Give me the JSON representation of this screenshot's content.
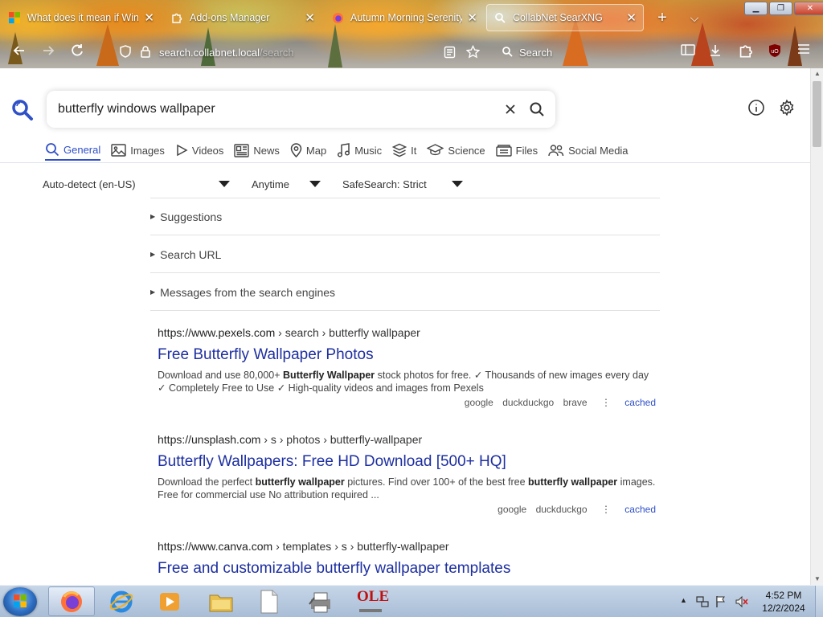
{
  "browser": {
    "tabs": [
      {
        "title": "What does it mean if Wind",
        "close": "✕",
        "icon": "windows-logo-icon"
      },
      {
        "title": "Add-ons Manager",
        "close": "✕",
        "icon": "puzzle-icon"
      },
      {
        "title": "Autumn Morning Serenity",
        "close": "✕",
        "icon": "firefox-icon"
      },
      {
        "title": "CollabNet SearXNG",
        "close": "✕",
        "icon": "search-icon",
        "active": true
      }
    ],
    "new_tab": "+",
    "tab_list": "⌵",
    "url": {
      "host": "search.collabnet.local",
      "path": "/search"
    },
    "searchbar_placeholder": "Search",
    "window_controls": {
      "minimize": "▁",
      "maximize": "❐",
      "close": "✕"
    }
  },
  "search": {
    "query": "butterfly windows wallpaper",
    "categories": [
      {
        "label": "General",
        "icon": "search-icon",
        "active": true
      },
      {
        "label": "Images",
        "icon": "image-icon"
      },
      {
        "label": "Videos",
        "icon": "play-icon"
      },
      {
        "label": "News",
        "icon": "newspaper-icon"
      },
      {
        "label": "Map",
        "icon": "map-pin-icon"
      },
      {
        "label": "Music",
        "icon": "music-icon"
      },
      {
        "label": "It",
        "icon": "layers-icon"
      },
      {
        "label": "Science",
        "icon": "graduation-cap-icon"
      },
      {
        "label": "Files",
        "icon": "files-icon"
      },
      {
        "label": "Social Media",
        "icon": "people-icon"
      }
    ],
    "filters": {
      "language": "Auto-detect (en-US)",
      "time": "Anytime",
      "safesearch": "SafeSearch: Strict"
    },
    "collapsibles": [
      "Suggestions",
      "Search URL",
      "Messages from the search engines"
    ]
  },
  "results": [
    {
      "host": "https://www.pexels.com",
      "path": "› search › butterfly wallpaper",
      "title": "Free Butterfly Wallpaper Photos",
      "content": [
        {
          "t": "Download and use 80,000+ "
        },
        {
          "t": "Butterfly Wallpaper",
          "b": true
        },
        {
          "t": " stock photos for free. ✓ Thousands of new images every day ✓ Completely Free to Use ✓ High-quality videos and images from Pexels"
        }
      ],
      "engines": [
        "google",
        "duckduckgo",
        "brave"
      ],
      "cached": "cached"
    },
    {
      "host": "https://unsplash.com",
      "path": "› s › photos › butterfly-wallpaper",
      "title": "Butterfly Wallpapers: Free HD Download [500+ HQ]",
      "content": [
        {
          "t": "Download the perfect "
        },
        {
          "t": "butterfly wallpaper",
          "b": true
        },
        {
          "t": " pictures. Find over 100+ of the best free "
        },
        {
          "t": "butterfly wallpaper",
          "b": true
        },
        {
          "t": " images. Free for commercial use No attribution required ..."
        }
      ],
      "engines": [
        "google",
        "duckduckgo"
      ],
      "cached": "cached"
    },
    {
      "host": "https://www.canva.com",
      "path": "› templates › s › butterfly-wallpaper",
      "title": "Free and customizable butterfly wallpaper templates",
      "content": [],
      "engines": [],
      "cached": ""
    }
  ],
  "taskbar": {
    "apps": [
      "firefox-icon",
      "internet-explorer-icon",
      "media-player-icon",
      "file-explorer-icon",
      "document-icon",
      "printer-app-icon",
      "ole-app-icon"
    ],
    "ole_label": "OLE",
    "clock": {
      "time": "4:52 PM",
      "date": "12/2/2024"
    }
  },
  "colors": {
    "accent": "#3050c8",
    "link": "#1d2fa0"
  }
}
